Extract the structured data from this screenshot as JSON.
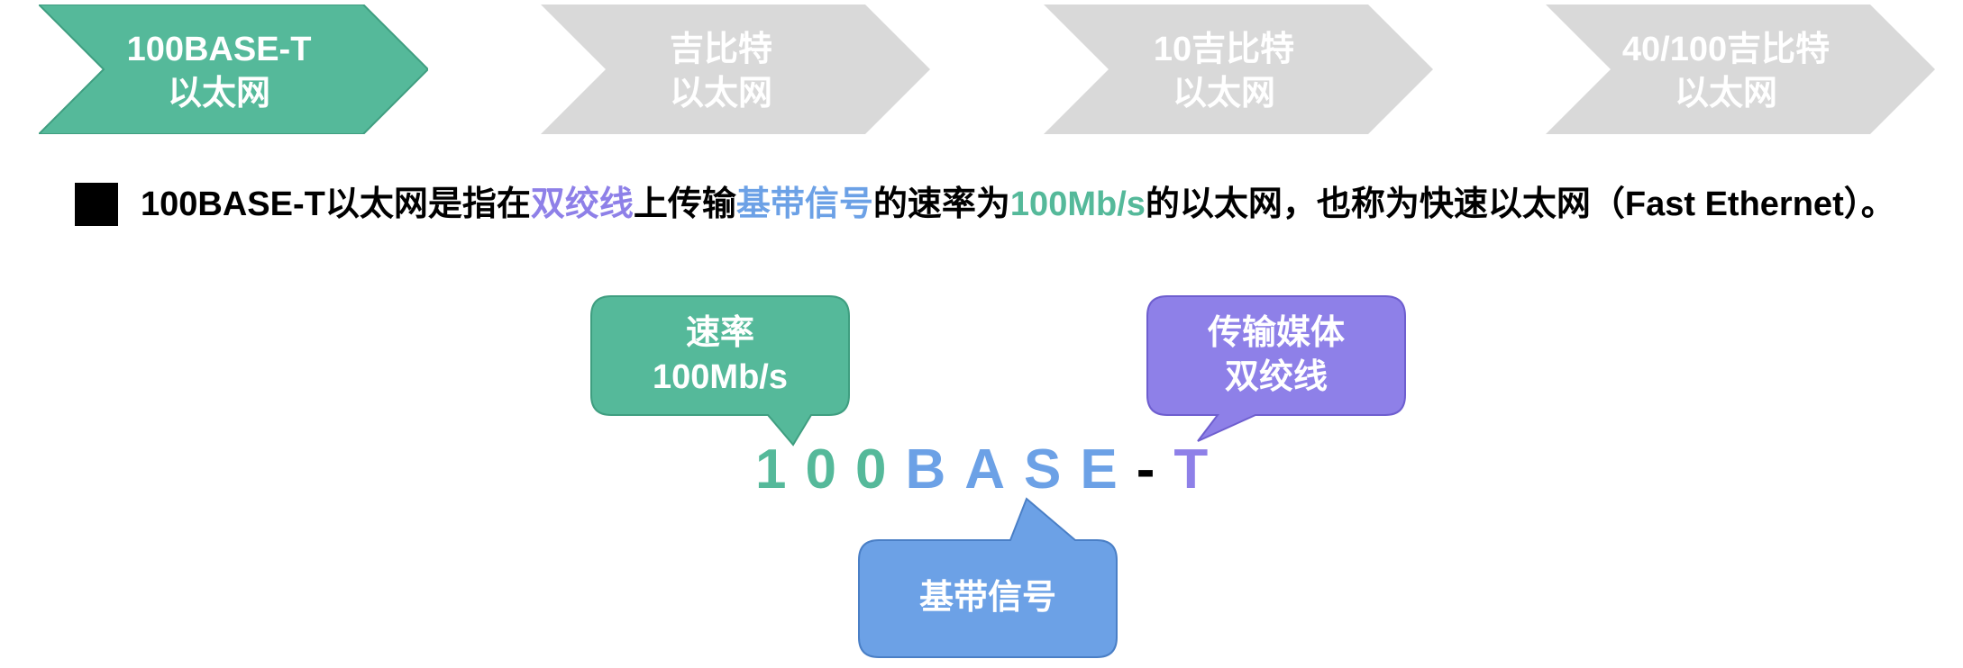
{
  "steps": [
    {
      "line1": "100BASE-T",
      "line2": "以太网",
      "active": true
    },
    {
      "line1": "吉比特",
      "line2": "以太网",
      "active": false
    },
    {
      "line1": "10吉比特",
      "line2": "以太网",
      "active": false
    },
    {
      "line1": "40/100吉比特",
      "line2": "以太网",
      "active": false
    }
  ],
  "sentence": {
    "p1": "100BASE-T以太网是指在",
    "hl1": "双绞线",
    "p2": "上传输",
    "hl2": "基带信号",
    "p3": "的速率为",
    "hl3": "100Mb/s",
    "p4": "的以太网，也称为快速以太网（Fast Ethernet）。"
  },
  "callouts": {
    "speed": {
      "line1": "速率",
      "line2": "100Mb/s"
    },
    "medium": {
      "line1": "传输媒体",
      "line2": "双绞线"
    },
    "signal": {
      "line1": "基带信号"
    }
  },
  "acronym": {
    "speed": "100",
    "base": "BASE",
    "dash": "-",
    "medium": "T"
  },
  "colors": {
    "green": "#55B99A",
    "green_border": "#3F9E80",
    "blue": "#6CA1E6",
    "blue_border": "#4A7FC6",
    "purple": "#8E80E8",
    "purple_border": "#6E5ECF",
    "gray": "#D9D9D9"
  }
}
